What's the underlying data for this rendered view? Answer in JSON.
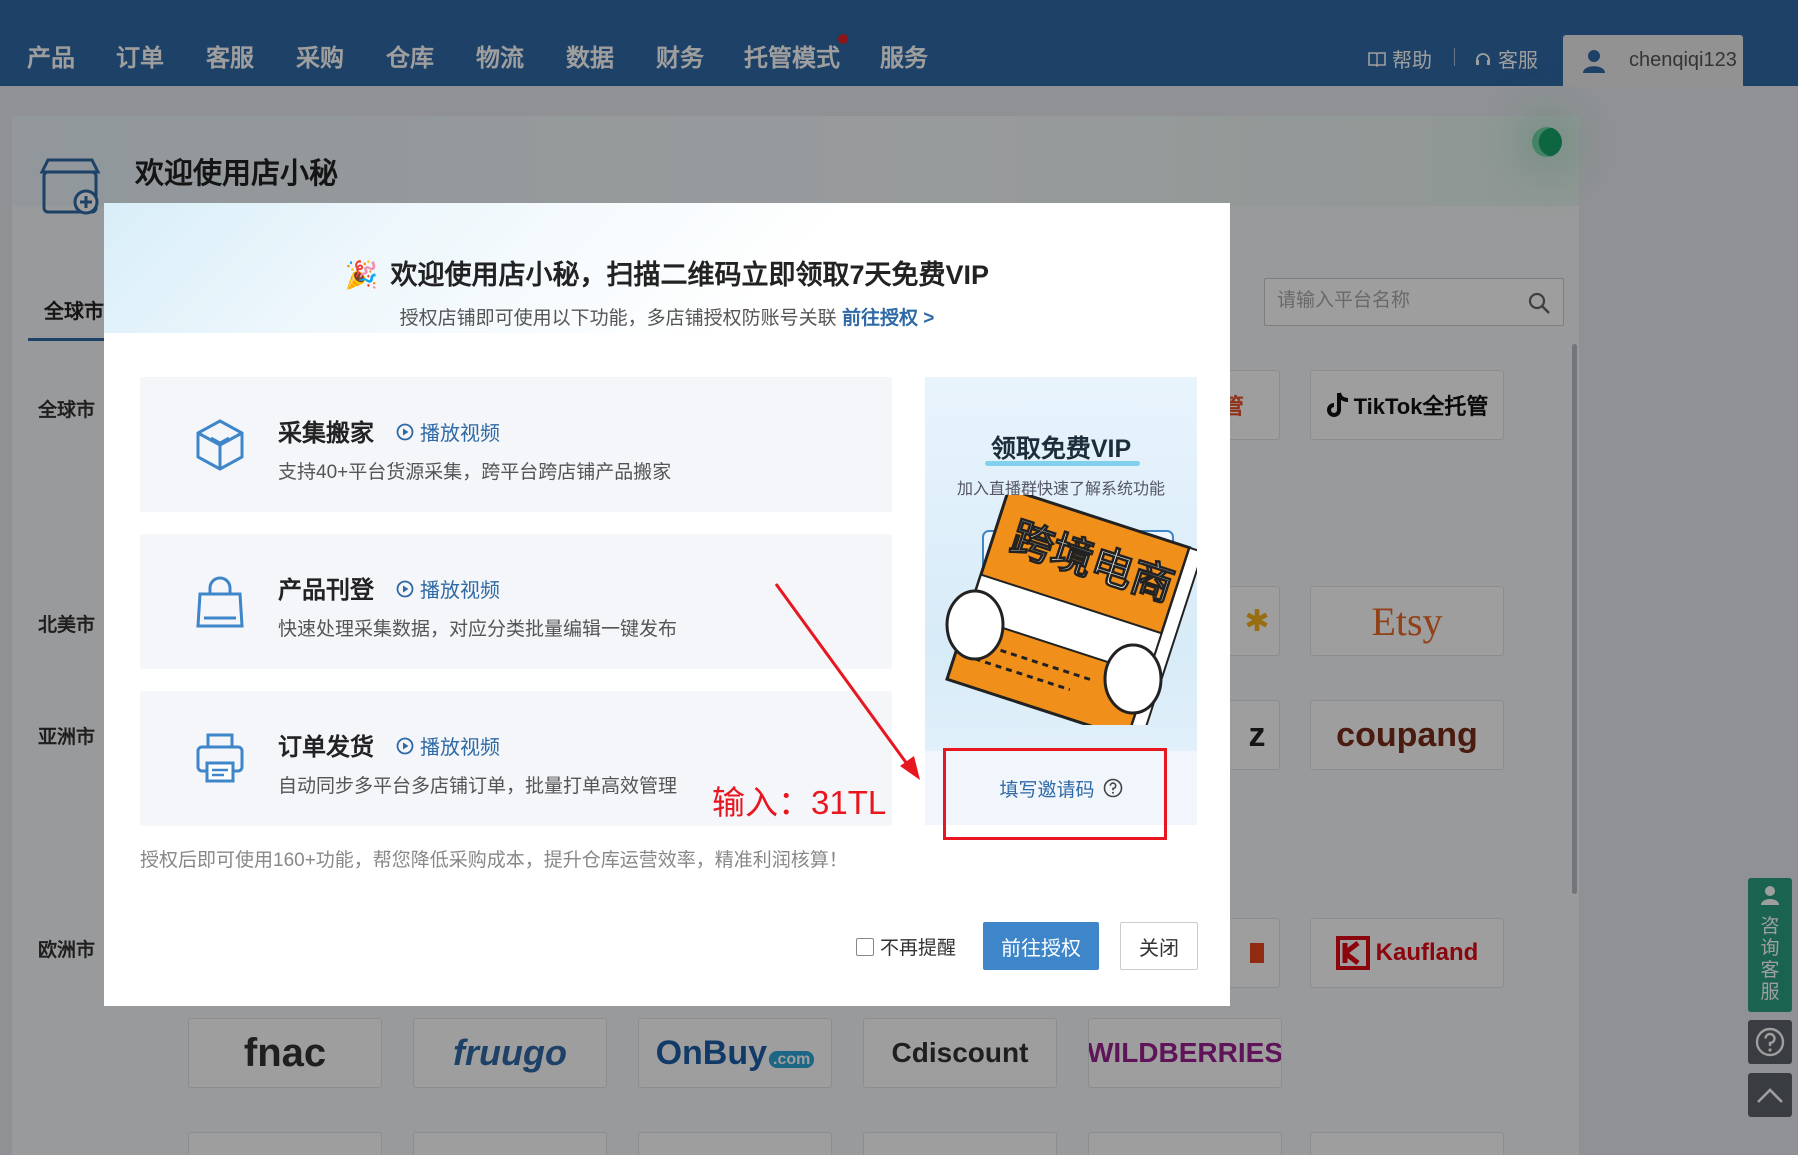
{
  "nav": {
    "items": [
      "产品",
      "订单",
      "客服",
      "采购",
      "仓库",
      "物流",
      "数据",
      "财务",
      "托管模式",
      "服务"
    ],
    "help": "帮助",
    "service": "客服",
    "username": "chenqiqi123",
    "accent": "#2f6aa6"
  },
  "page": {
    "welcome_title": "欢迎使用店小秘",
    "tab_global": "全球市",
    "search_placeholder": "请输入平台名称",
    "regions": [
      "全球市",
      "北美市",
      "亚洲市",
      "欧洲市"
    ],
    "platforms_right": [
      "托管",
      "TikTok全托管",
      "Etsy",
      "coupang",
      "Kaufland"
    ],
    "platforms_bottom": [
      "fnac",
      "fruugo",
      "OnBuy",
      ".com",
      "Cdiscount",
      "WILDBERRIES"
    ],
    "partial_logos": [
      "z"
    ]
  },
  "side_tools": {
    "consult": "咨询客服"
  },
  "modal": {
    "title": "欢迎使用店小秘，扫描二维码立即领取7天免费VIP",
    "subtitle": "授权店铺即可使用以下功能，多店铺授权防账号关联",
    "subtitle_link": "前往授权 >",
    "features": [
      {
        "title": "采集搬家",
        "video": "播放视频",
        "desc": "支持40+平台货源采集，跨平台跨店铺产品搬家",
        "icon": "box-icon"
      },
      {
        "title": "产品刊登",
        "video": "播放视频",
        "desc": "快速处理采集数据，对应分类批量编辑一键发布",
        "icon": "shopping-bag-icon"
      },
      {
        "title": "订单发货",
        "video": "播放视频",
        "desc": "自动同步多平台多店铺订单，批量打单高效管理",
        "icon": "printer-icon"
      }
    ],
    "footer_note": "授权后即可使用160+功能，帮您降低采购成本，提升仓库运营效率，精准利润核算！",
    "dont_remind": "不再提醒",
    "primary_btn": "前往授权",
    "close_btn": "关闭",
    "promo": {
      "title": "领取免费VIP",
      "subtitle": "加入直播群快速了解系统功能",
      "book_text": "跨境电商",
      "invite_label": "填写邀请码"
    }
  },
  "annotation": {
    "text": "输入：31TL",
    "color": "#e8161e"
  }
}
